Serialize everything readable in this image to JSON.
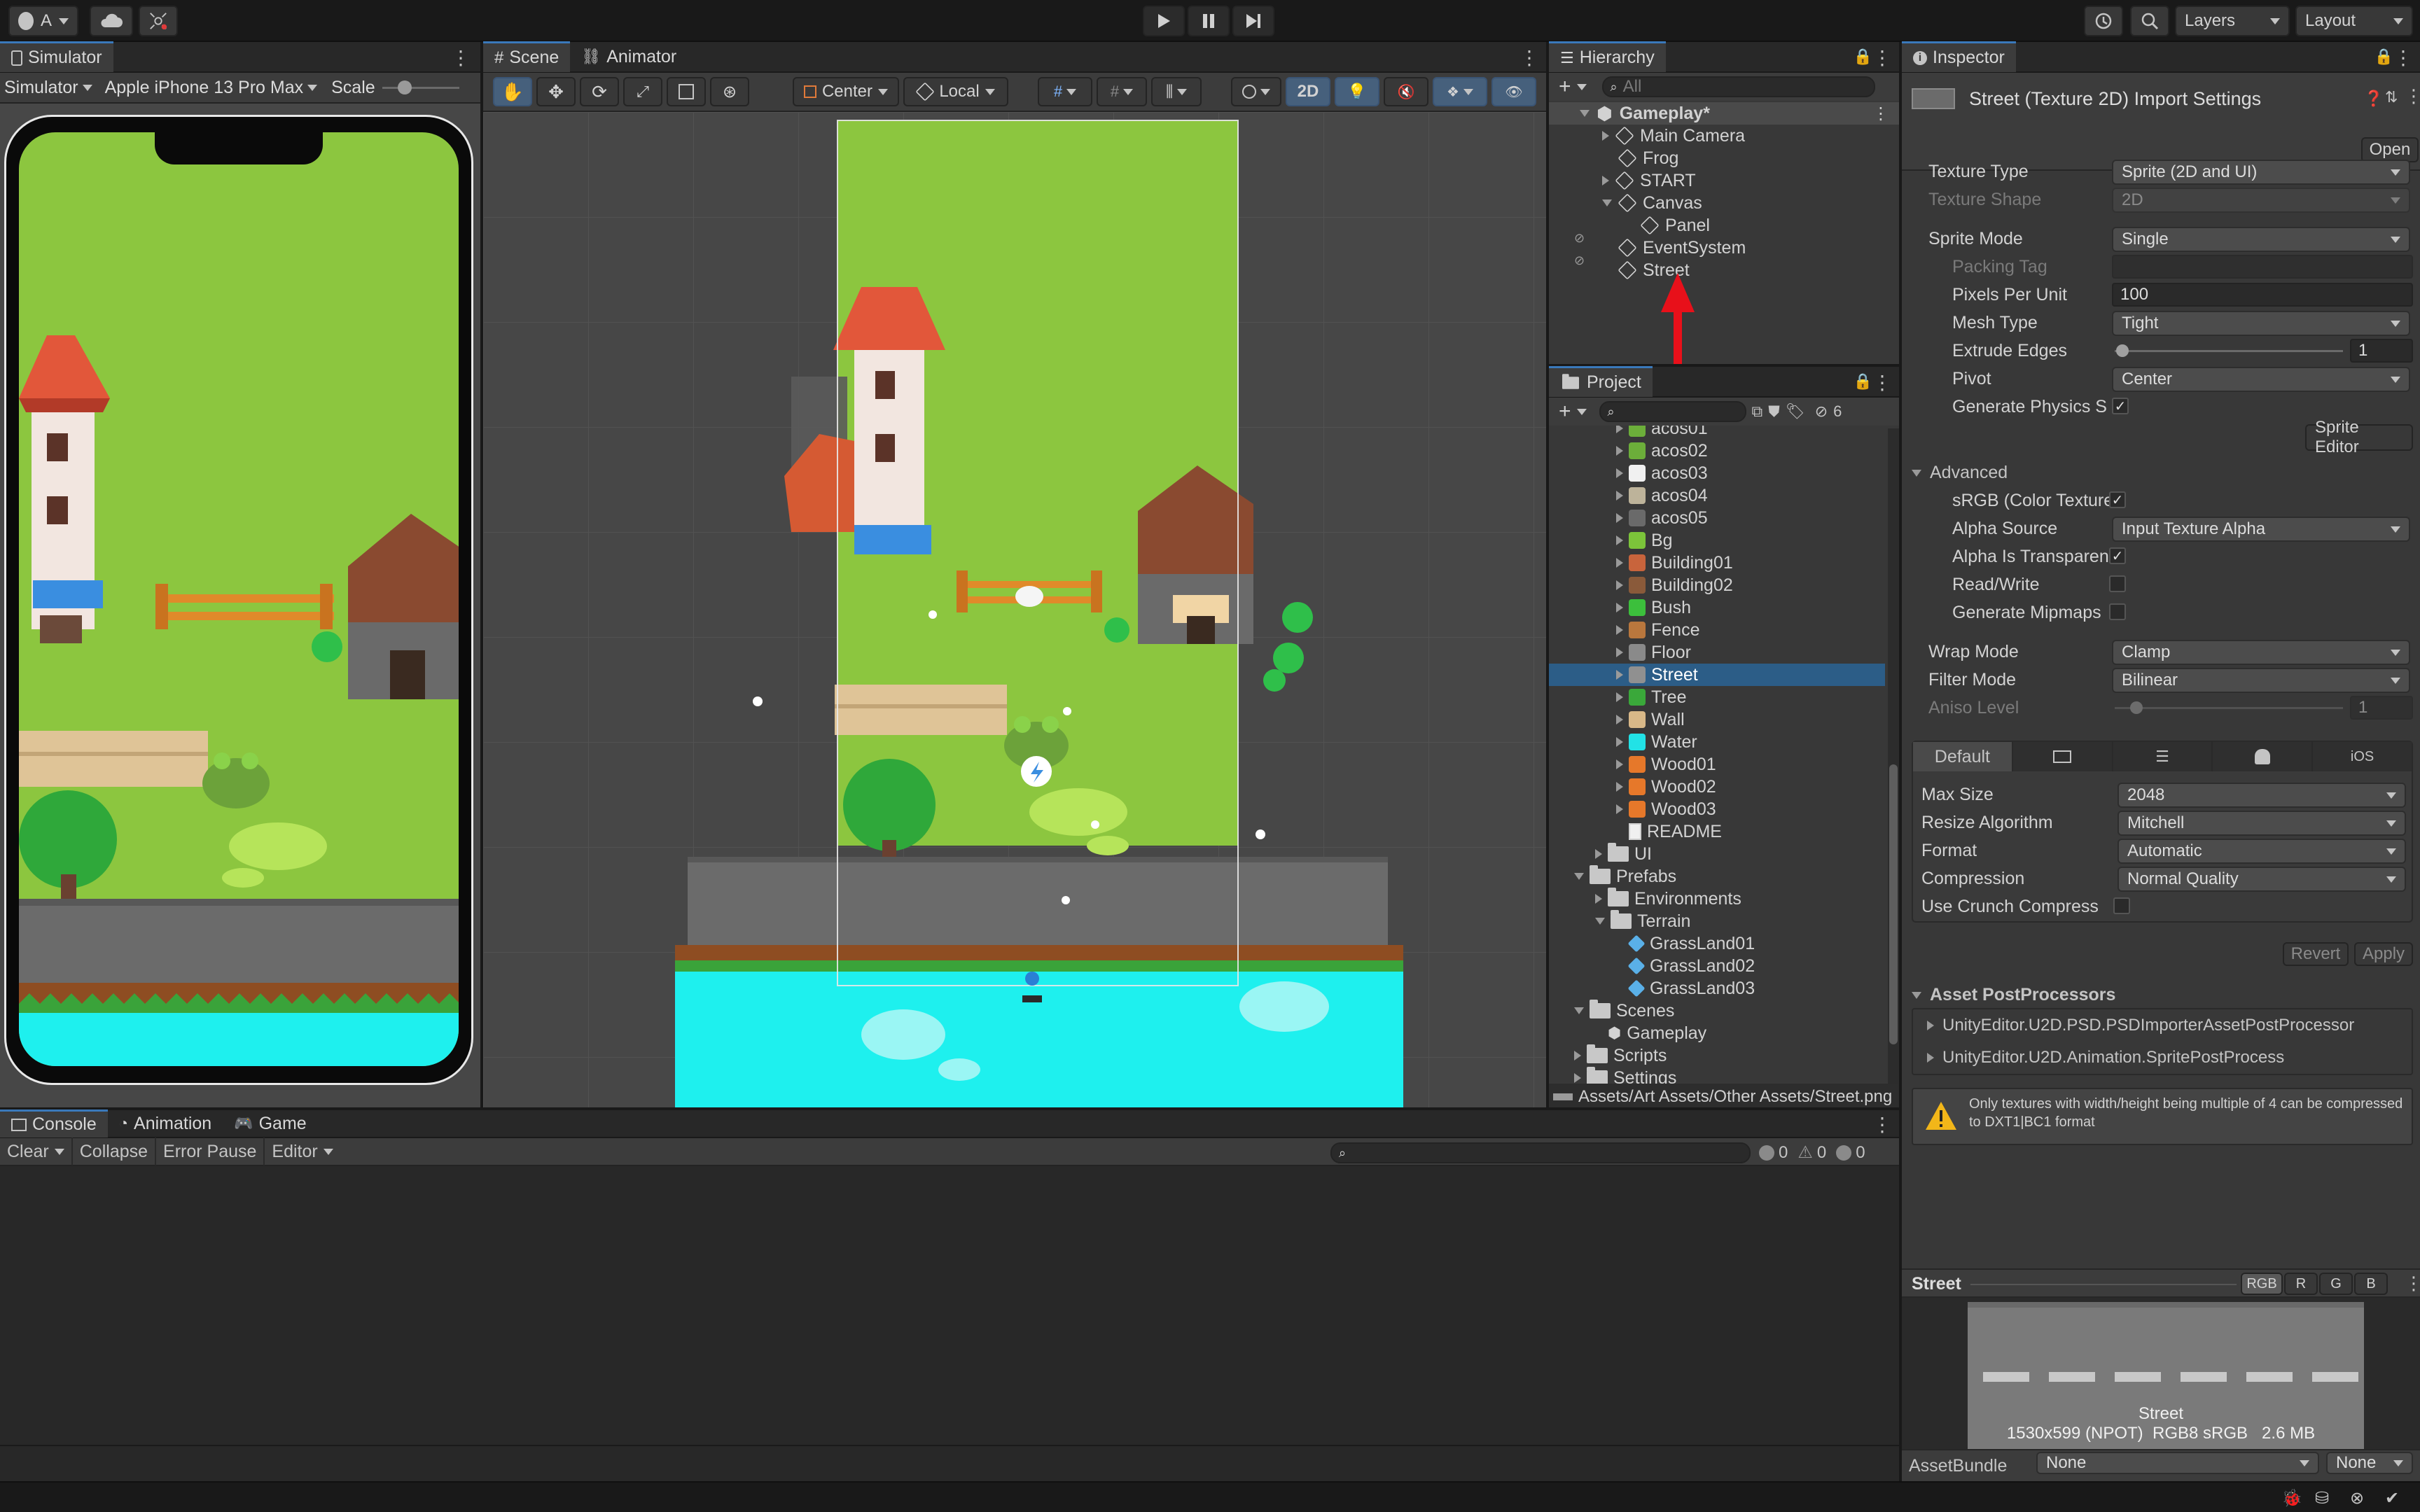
{
  "topbar": {
    "account_label": "A",
    "layers_label": "Layers",
    "layout_label": "Layout"
  },
  "simulator": {
    "tab": "Simulator",
    "mode": "Simulator",
    "device": "Apple iPhone 13 Pro Max",
    "scale_label": "Scale"
  },
  "scene": {
    "tab_scene": "Scene",
    "tab_animator": "Animator",
    "pivot": "Center",
    "space": "Local",
    "mode_2d": "2D"
  },
  "hierarchy": {
    "tab": "Hierarchy",
    "search_placeholder": "All",
    "root": "Gameplay*",
    "items": [
      {
        "label": "Main Camera",
        "depth": 1,
        "expand": "right"
      },
      {
        "label": "Frog",
        "depth": 1,
        "expand": "none"
      },
      {
        "label": "START",
        "depth": 1,
        "expand": "right"
      },
      {
        "label": "Canvas",
        "depth": 1,
        "expand": "down"
      },
      {
        "label": "Panel",
        "depth": 2,
        "expand": "none"
      },
      {
        "label": "EventSystem",
        "depth": 1,
        "expand": "none"
      },
      {
        "label": "Street",
        "depth": 1,
        "expand": "none"
      }
    ]
  },
  "project": {
    "tab": "Project",
    "hidden_count": "6",
    "items": [
      {
        "label": "acos01",
        "depth": 2,
        "icon": "sprite",
        "color": "#6cae3a"
      },
      {
        "label": "acos02",
        "depth": 2,
        "icon": "sprite",
        "color": "#6cae3a"
      },
      {
        "label": "acos03",
        "depth": 2,
        "icon": "sprite",
        "color": "#f0f0f0"
      },
      {
        "label": "acos04",
        "depth": 2,
        "icon": "sprite",
        "color": "#bdb39a"
      },
      {
        "label": "acos05",
        "depth": 2,
        "icon": "sprite",
        "color": "#6a6a6a"
      },
      {
        "label": "Bg",
        "depth": 2,
        "icon": "sprite",
        "color": "#7cc43a"
      },
      {
        "label": "Building01",
        "depth": 2,
        "icon": "sprite",
        "color": "#c8643c"
      },
      {
        "label": "Building02",
        "depth": 2,
        "icon": "sprite",
        "color": "#8a5a3a"
      },
      {
        "label": "Bush",
        "depth": 2,
        "icon": "sprite",
        "color": "#3cbf3c"
      },
      {
        "label": "Fence",
        "depth": 2,
        "icon": "sprite",
        "color": "#b9773d"
      },
      {
        "label": "Floor",
        "depth": 2,
        "icon": "sprite",
        "color": "#8a8a8a"
      },
      {
        "label": "Street",
        "depth": 2,
        "icon": "sprite",
        "color": "#909090",
        "selected": true
      },
      {
        "label": "Tree",
        "depth": 2,
        "icon": "sprite",
        "color": "#3aa83a"
      },
      {
        "label": "Wall",
        "depth": 2,
        "icon": "sprite",
        "color": "#d8b888"
      },
      {
        "label": "Water",
        "depth": 2,
        "icon": "sprite",
        "color": "#22e2e6"
      },
      {
        "label": "Wood01",
        "depth": 2,
        "icon": "sprite",
        "color": "#e6782a"
      },
      {
        "label": "Wood02",
        "depth": 2,
        "icon": "sprite",
        "color": "#e6782a"
      },
      {
        "label": "Wood03",
        "depth": 2,
        "icon": "sprite",
        "color": "#e6782a"
      },
      {
        "label": "README",
        "depth": 2,
        "icon": "doc",
        "color": "#d0d0d0"
      },
      {
        "label": "UI",
        "depth": 1,
        "icon": "folder",
        "color": "#c8c8c8",
        "expand": "right"
      },
      {
        "label": "Prefabs",
        "depth": 0,
        "icon": "folder",
        "color": "#c8c8c8",
        "expand": "down"
      },
      {
        "label": "Environments",
        "depth": 1,
        "icon": "folder",
        "color": "#c8c8c8",
        "expand": "right"
      },
      {
        "label": "Terrain",
        "depth": 1,
        "icon": "folder",
        "color": "#c8c8c8",
        "expand": "down"
      },
      {
        "label": "GrassLand01",
        "depth": 2,
        "icon": "prefab",
        "color": "#5ab0e8"
      },
      {
        "label": "GrassLand02",
        "depth": 2,
        "icon": "prefab",
        "color": "#5ab0e8"
      },
      {
        "label": "GrassLand03",
        "depth": 2,
        "icon": "prefab",
        "color": "#5ab0e8"
      },
      {
        "label": "Scenes",
        "depth": 0,
        "icon": "folder",
        "color": "#c8c8c8",
        "expand": "down"
      },
      {
        "label": "Gameplay",
        "depth": 1,
        "icon": "unity",
        "color": "#d0d0d0"
      },
      {
        "label": "Scripts",
        "depth": 0,
        "icon": "folder",
        "color": "#c8c8c8",
        "expand": "right"
      },
      {
        "label": "Settings",
        "depth": 0,
        "icon": "folder",
        "color": "#c8c8c8",
        "expand": "right"
      }
    ],
    "path": "Assets/Art Assets/Other Assets/Street.png"
  },
  "inspector": {
    "tab": "Inspector",
    "title": "Street (Texture 2D) Import Settings",
    "open_label": "Open",
    "texture_type": {
      "label": "Texture Type",
      "value": "Sprite (2D and UI)"
    },
    "texture_shape": {
      "label": "Texture Shape",
      "value": "2D"
    },
    "sprite_mode": {
      "label": "Sprite Mode",
      "value": "Single"
    },
    "packing_tag": {
      "label": "Packing Tag",
      "value": ""
    },
    "pixels_per_unit": {
      "label": "Pixels Per Unit",
      "value": "100"
    },
    "mesh_type": {
      "label": "Mesh Type",
      "value": "Tight"
    },
    "extrude_edges": {
      "label": "Extrude Edges",
      "value": "1"
    },
    "pivot": {
      "label": "Pivot",
      "value": "Center"
    },
    "generate_physics": {
      "label": "Generate Physics S",
      "checked": true
    },
    "sprite_editor_label": "Sprite Editor",
    "advanced_label": "Advanced",
    "srgb": {
      "label": "sRGB (Color Texture",
      "checked": true
    },
    "alpha_source": {
      "label": "Alpha Source",
      "value": "Input Texture Alpha"
    },
    "alpha_transparency": {
      "label": "Alpha Is Transparen",
      "checked": true
    },
    "read_write": {
      "label": "Read/Write",
      "checked": false
    },
    "mipmaps": {
      "label": "Generate Mipmaps",
      "checked": false
    },
    "wrap_mode": {
      "label": "Wrap Mode",
      "value": "Clamp"
    },
    "filter_mode": {
      "label": "Filter Mode",
      "value": "Bilinear"
    },
    "aniso_level": {
      "label": "Aniso Level",
      "value": "1"
    },
    "platform_tabs": [
      "Default",
      "monitor-icon",
      "server-icon",
      "android-icon",
      "iOS"
    ],
    "max_size": {
      "label": "Max Size",
      "value": "2048"
    },
    "resize_algorithm": {
      "label": "Resize Algorithm",
      "value": "Mitchell"
    },
    "format": {
      "label": "Format",
      "value": "Automatic"
    },
    "compression": {
      "label": "Compression",
      "value": "Normal Quality"
    },
    "crunch": {
      "label": "Use Crunch Compress",
      "checked": false
    },
    "revert_label": "Revert",
    "apply_label": "Apply",
    "postprocessors_label": "Asset PostProcessors",
    "postprocessors": [
      "UnityEditor.U2D.PSD.PSDImporterAssetPostProcessor",
      "UnityEditor.U2D.Animation.SpritePostProcess"
    ],
    "warning": "Only textures with width/height being multiple of 4 can be compressed to DXT1|BC1 format",
    "preview": {
      "name": "Street",
      "channels": [
        "RGB",
        "R",
        "G",
        "B"
      ],
      "caption_name": "Street",
      "caption_info": "1530x599 (NPOT)  RGB8 sRGB   2.6 MB"
    },
    "assetbundle": {
      "label": "AssetBundle",
      "value": "None",
      "variant": "None"
    }
  },
  "console": {
    "tabs": [
      "Console",
      "Animation",
      "Game"
    ],
    "clear_label": "Clear",
    "collapse_label": "Collapse",
    "error_pause_label": "Error Pause",
    "editor_label": "Editor",
    "counts": {
      "info": "0",
      "warn": "0",
      "error": "0"
    }
  },
  "colors": {
    "accent": "#3a79bb",
    "selection": "#2c5d87",
    "grass": "#8cc63f",
    "water": "#1ef0ee",
    "annotation_arrow": "#e8101a"
  }
}
